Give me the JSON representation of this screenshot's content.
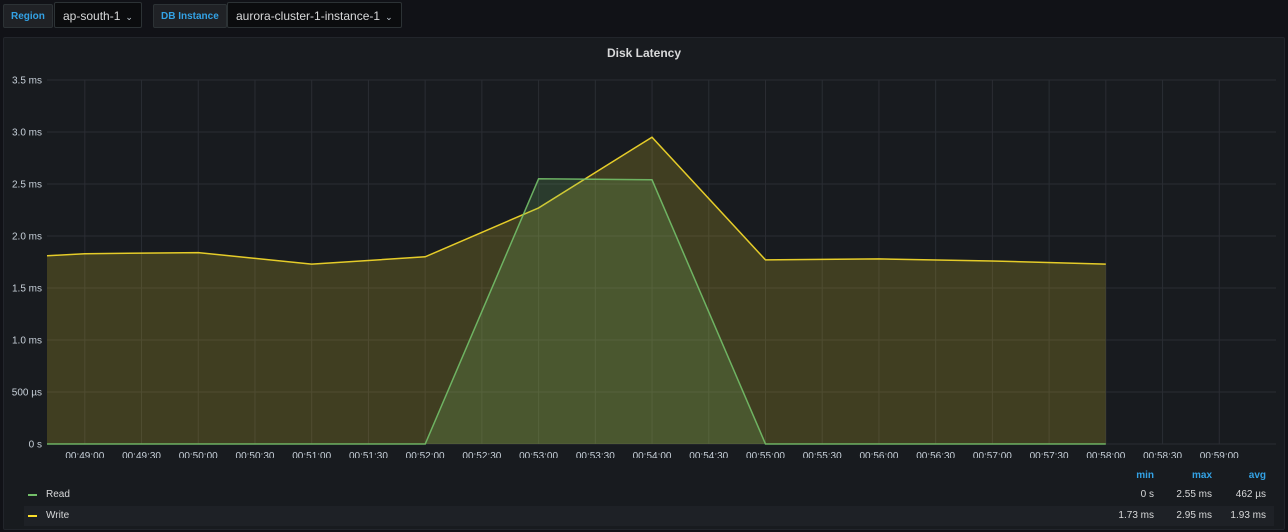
{
  "toolbar": {
    "region_label": "Region",
    "region_value": "ap-south-1",
    "instance_label": "DB Instance",
    "instance_value": "aurora-cluster-1-instance-1",
    "caret_icon": "chevron-down-icon"
  },
  "panel": {
    "title": "Disk Latency"
  },
  "legend": {
    "headers": {
      "min": "min",
      "max": "max",
      "avg": "avg"
    },
    "series": [
      {
        "name": "Read",
        "min": "0 s",
        "max": "2.55 ms",
        "avg": "462 µs"
      },
      {
        "name": "Write",
        "min": "1.73 ms",
        "max": "2.95 ms",
        "avg": "1.93 ms"
      }
    ]
  },
  "chart_data": {
    "type": "area",
    "title": "Disk Latency",
    "xlabel": "",
    "ylabel": "",
    "y_unit": "ms",
    "ylim": [
      0,
      3.5
    ],
    "y_ticks": [
      {
        "value": 0,
        "label": "0 s"
      },
      {
        "value": 0.5,
        "label": "500 µs"
      },
      {
        "value": 1.0,
        "label": "1.0 ms"
      },
      {
        "value": 1.5,
        "label": "1.5 ms"
      },
      {
        "value": 2.0,
        "label": "2.0 ms"
      },
      {
        "value": 2.5,
        "label": "2.5 ms"
      },
      {
        "value": 3.0,
        "label": "3.0 ms"
      },
      {
        "value": 3.5,
        "label": "3.5 ms"
      }
    ],
    "xlim": [
      "00:48:40",
      "00:59:30"
    ],
    "x_ticks": [
      "00:49:00",
      "00:49:30",
      "00:50:00",
      "00:50:30",
      "00:51:00",
      "00:51:30",
      "00:52:00",
      "00:52:30",
      "00:53:00",
      "00:53:30",
      "00:54:00",
      "00:54:30",
      "00:55:00",
      "00:55:30",
      "00:56:00",
      "00:56:30",
      "00:57:00",
      "00:57:30",
      "00:58:00",
      "00:58:30",
      "00:59:00"
    ],
    "grid": true,
    "legend_placement": "bottom",
    "series": [
      {
        "name": "Read",
        "color": "#73bf69",
        "points": [
          [
            "00:48:40",
            0
          ],
          [
            "00:52:00",
            0
          ],
          [
            "00:53:00",
            2.55
          ],
          [
            "00:54:00",
            2.54
          ],
          [
            "00:55:00",
            0
          ],
          [
            "00:58:00",
            0
          ]
        ]
      },
      {
        "name": "Write",
        "color": "#fade2a",
        "points": [
          [
            "00:48:40",
            1.81
          ],
          [
            "00:49:00",
            1.83
          ],
          [
            "00:50:00",
            1.84
          ],
          [
            "00:51:00",
            1.73
          ],
          [
            "00:52:00",
            1.8
          ],
          [
            "00:53:00",
            2.27
          ],
          [
            "00:54:00",
            2.95
          ],
          [
            "00:55:00",
            1.77
          ],
          [
            "00:56:00",
            1.78
          ],
          [
            "00:57:00",
            1.76
          ],
          [
            "00:58:00",
            1.73
          ]
        ]
      }
    ]
  }
}
